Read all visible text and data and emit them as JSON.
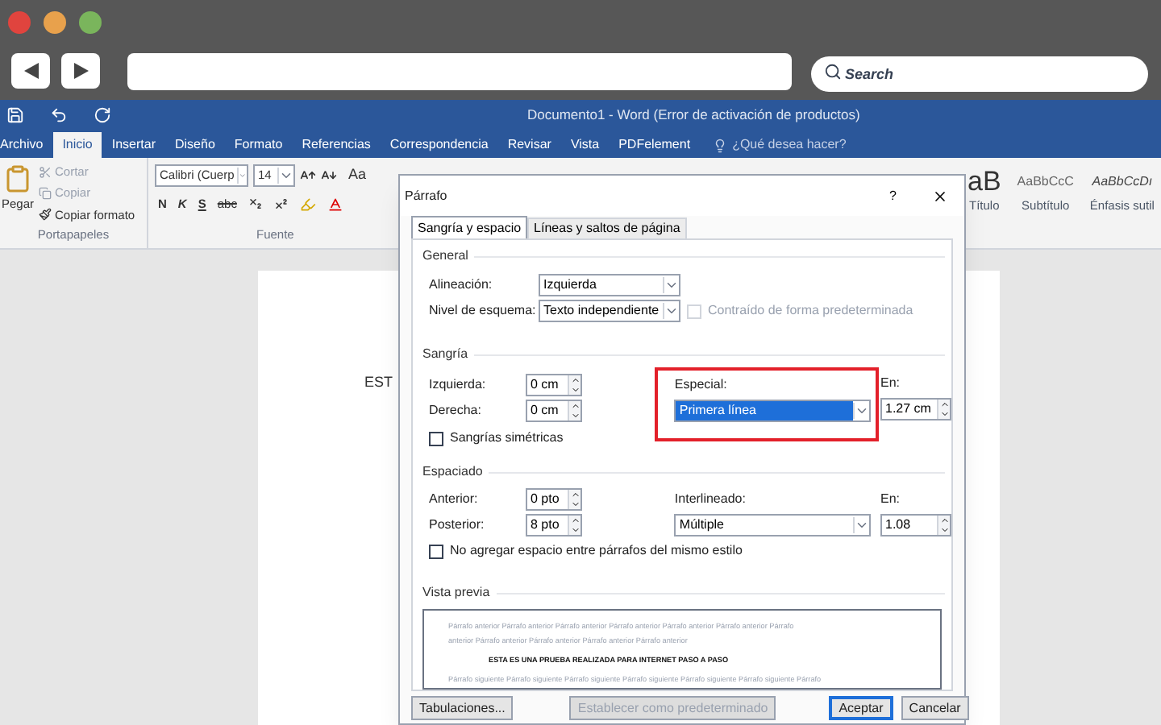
{
  "browser": {
    "search": {
      "placeholder": "Search"
    }
  },
  "word": {
    "title": "Documento1 - Word (Error de activación de productos)",
    "tabs": [
      {
        "label": "Archivo",
        "selected": false
      },
      {
        "label": "Inicio",
        "selected": true
      },
      {
        "label": "Insertar",
        "selected": false
      },
      {
        "label": "Diseño",
        "selected": false
      },
      {
        "label": "Formato",
        "selected": false
      },
      {
        "label": "Referencias",
        "selected": false
      },
      {
        "label": "Correspondencia",
        "selected": false
      },
      {
        "label": "Revisar",
        "selected": false
      },
      {
        "label": "Vista",
        "selected": false
      },
      {
        "label": "PDFelement",
        "selected": false
      }
    ],
    "tell_me": {
      "placeholder": "¿Qué desea hacer?"
    },
    "clipboard": {
      "paste": "Pegar",
      "group": "Portapapeles",
      "actions": [
        {
          "label": "Cortar",
          "disabled": true
        },
        {
          "label": "Copiar",
          "disabled": true
        },
        {
          "label": "Copiar formato",
          "disabled": false
        }
      ]
    },
    "font": {
      "name": "Calibri (Cuerp",
      "size": "14",
      "change_case": "Aa",
      "bold": "N",
      "italic": "K",
      "underline": "S",
      "strikethrough": "abc",
      "group": "Fuente"
    },
    "styles": [
      {
        "sample": "aB",
        "name": "Título"
      },
      {
        "sample": "AaBbCcC",
        "name": "Subtítulo"
      },
      {
        "sample": "AaBbCcDı",
        "name": "Énfasis sutil"
      }
    ],
    "document": {
      "text": "EST"
    }
  },
  "dialog": {
    "title": "Párrafo",
    "help": "?",
    "tabs": [
      {
        "label": "Sangría y espacio",
        "selected": true
      },
      {
        "label": "Líneas y saltos de página",
        "selected": false
      }
    ],
    "general": {
      "heading": "General",
      "alignment": {
        "label": "Alineación:",
        "value": "Izquierda"
      },
      "outline": {
        "label": "Nivel de esquema:",
        "value": "Texto independiente"
      },
      "collapsed": {
        "label": "Contraído de forma predeterminada",
        "checked": false,
        "disabled": true
      }
    },
    "indent": {
      "heading": "Sangría",
      "left": {
        "label": "Izquierda:",
        "value": "0 cm"
      },
      "right": {
        "label": "Derecha:",
        "value": "0 cm"
      },
      "mirror": {
        "label": "Sangrías simétricas",
        "checked": false
      },
      "special": {
        "label": "Especial:",
        "value": "Primera línea",
        "focused": true,
        "annotated": true
      },
      "by": {
        "label": "En:",
        "value": "1.27 cm"
      }
    },
    "spacing": {
      "heading": "Espaciado",
      "before": {
        "label": "Anterior:",
        "value": "0 pto"
      },
      "after": {
        "label": "Posterior:",
        "value": "8 pto"
      },
      "line": {
        "label": "Interlineado:",
        "value": "Múltiple"
      },
      "at": {
        "label": "En:",
        "value": "1.08"
      },
      "no_space": {
        "label": "No agregar espacio entre párrafos del mismo estilo",
        "checked": false
      }
    },
    "preview": {
      "heading": "Vista previa",
      "lines": [
        {
          "kind": "previous",
          "text": "Párrafo anterior Párrafo anterior Párrafo anterior Párrafo anterior Párrafo anterior Párrafo anterior Párrafo"
        },
        {
          "kind": "previous",
          "text": "anterior Párrafo anterior Párrafo anterior Párrafo anterior Párrafo anterior"
        },
        {
          "kind": "current",
          "text": "ESTA ES UNA PRUEBA REALIZADA PARA INTERNET PASO A PASO"
        },
        {
          "kind": "next",
          "text": "Párrafo siguiente Párrafo siguiente Párrafo siguiente Párrafo siguiente Párrafo siguiente Párrafo siguiente Párrafo"
        }
      ]
    },
    "buttons": [
      {
        "label": "Tabulaciones...",
        "disabled": false,
        "default": false
      },
      {
        "label": "Establecer como predeterminado",
        "disabled": true,
        "default": false
      },
      {
        "label": "Aceptar",
        "disabled": false,
        "default": true
      },
      {
        "label": "Cancelar",
        "disabled": false,
        "default": false
      }
    ]
  }
}
